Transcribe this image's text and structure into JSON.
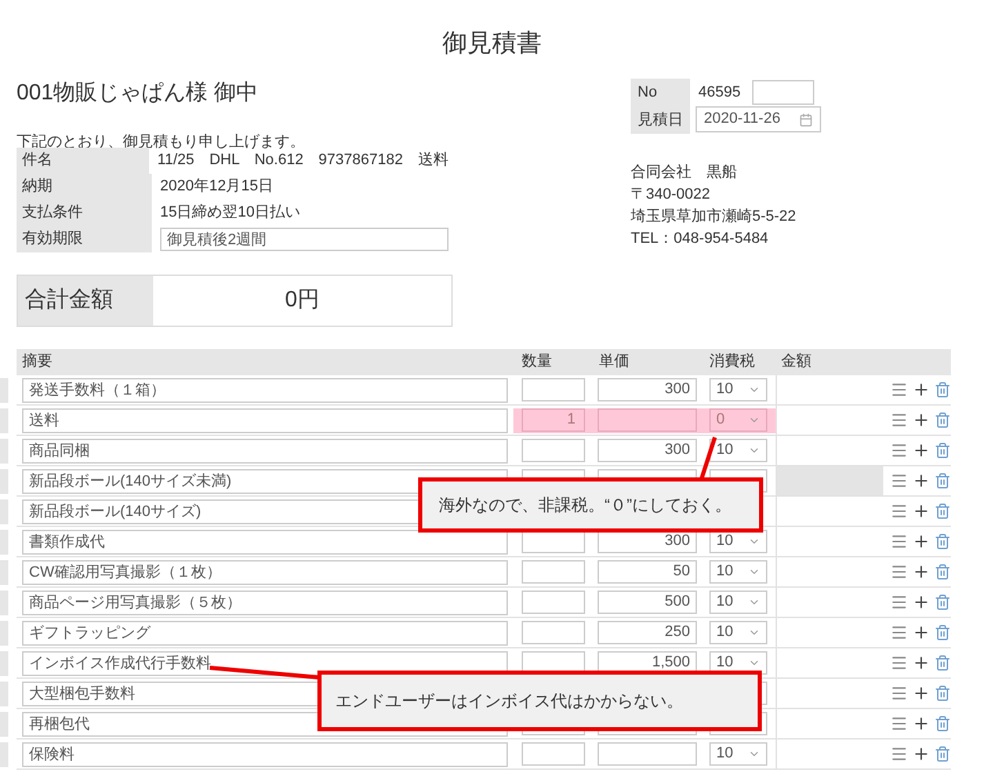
{
  "title": "御見積書",
  "customer": "001物販じゃぱん様 御中",
  "greeting": "下記のとおり、御見積もり申し上げます。",
  "info": [
    {
      "label": "件名",
      "value": "11/25　DHL　No.612　9737867182　送料",
      "kind": "text"
    },
    {
      "label": "納期",
      "value": "2020年12月15日",
      "kind": "text"
    },
    {
      "label": "支払条件",
      "value": "15日締め翌10日払い",
      "kind": "text"
    },
    {
      "label": "有効期限",
      "value": "御見積後2週間",
      "kind": "input"
    }
  ],
  "total": {
    "label": "合計金額",
    "value": "0円"
  },
  "meta": {
    "no_label": "No",
    "no_value": "46595",
    "date_label": "見積日",
    "date_value": "2020-11-26"
  },
  "company": [
    "合同会社　黒船",
    "〒340-0022",
    "埼玉県草加市瀬崎5-5-22",
    "TEL：048-954-5484"
  ],
  "table": {
    "columns": [
      "摘要",
      "数量",
      "単価",
      "消費税",
      "金額"
    ],
    "rows": [
      {
        "item": "発送手数料（１箱）",
        "price": "300",
        "tax": "10",
        "highlighted": false,
        "shaded": false
      },
      {
        "item": "送料",
        "qty": "1",
        "tax": "0",
        "highlighted": true,
        "shaded": false
      },
      {
        "item": "商品同梱",
        "price": "300",
        "tax": "10",
        "highlighted": false,
        "shaded": false
      },
      {
        "item": "新品段ボール(140サイズ未満)",
        "highlighted": false,
        "shaded": true
      },
      {
        "item": "新品段ボール(140サイズ)",
        "highlighted": false,
        "shaded": false
      },
      {
        "item": "書類作成代",
        "price": "300",
        "tax": "10",
        "highlighted": false,
        "shaded": false
      },
      {
        "item": "CW確認用写真撮影（１枚）",
        "price": "50",
        "tax": "10",
        "highlighted": false,
        "shaded": false
      },
      {
        "item": "商品ページ用写真撮影（５枚）",
        "price": "500",
        "tax": "10",
        "highlighted": false,
        "shaded": false
      },
      {
        "item": "ギフトラッピング",
        "price": "250",
        "tax": "10",
        "highlighted": false,
        "shaded": false
      },
      {
        "item": "インボイス作成代行手数料",
        "price": "1,500",
        "tax": "10",
        "highlighted": false,
        "shaded": false
      },
      {
        "item": "大型梱包手数料",
        "highlighted": false,
        "shaded": false
      },
      {
        "item": "再梱包代",
        "highlighted": false,
        "shaded": false
      },
      {
        "item": "保険料",
        "tax": "10",
        "highlighted": false,
        "shaded": false
      }
    ]
  },
  "callouts": [
    {
      "text": "海外なので、非課税。“０”にしておく。"
    },
    {
      "text": "エンドユーザーはインボイス代はかからない。"
    }
  ]
}
